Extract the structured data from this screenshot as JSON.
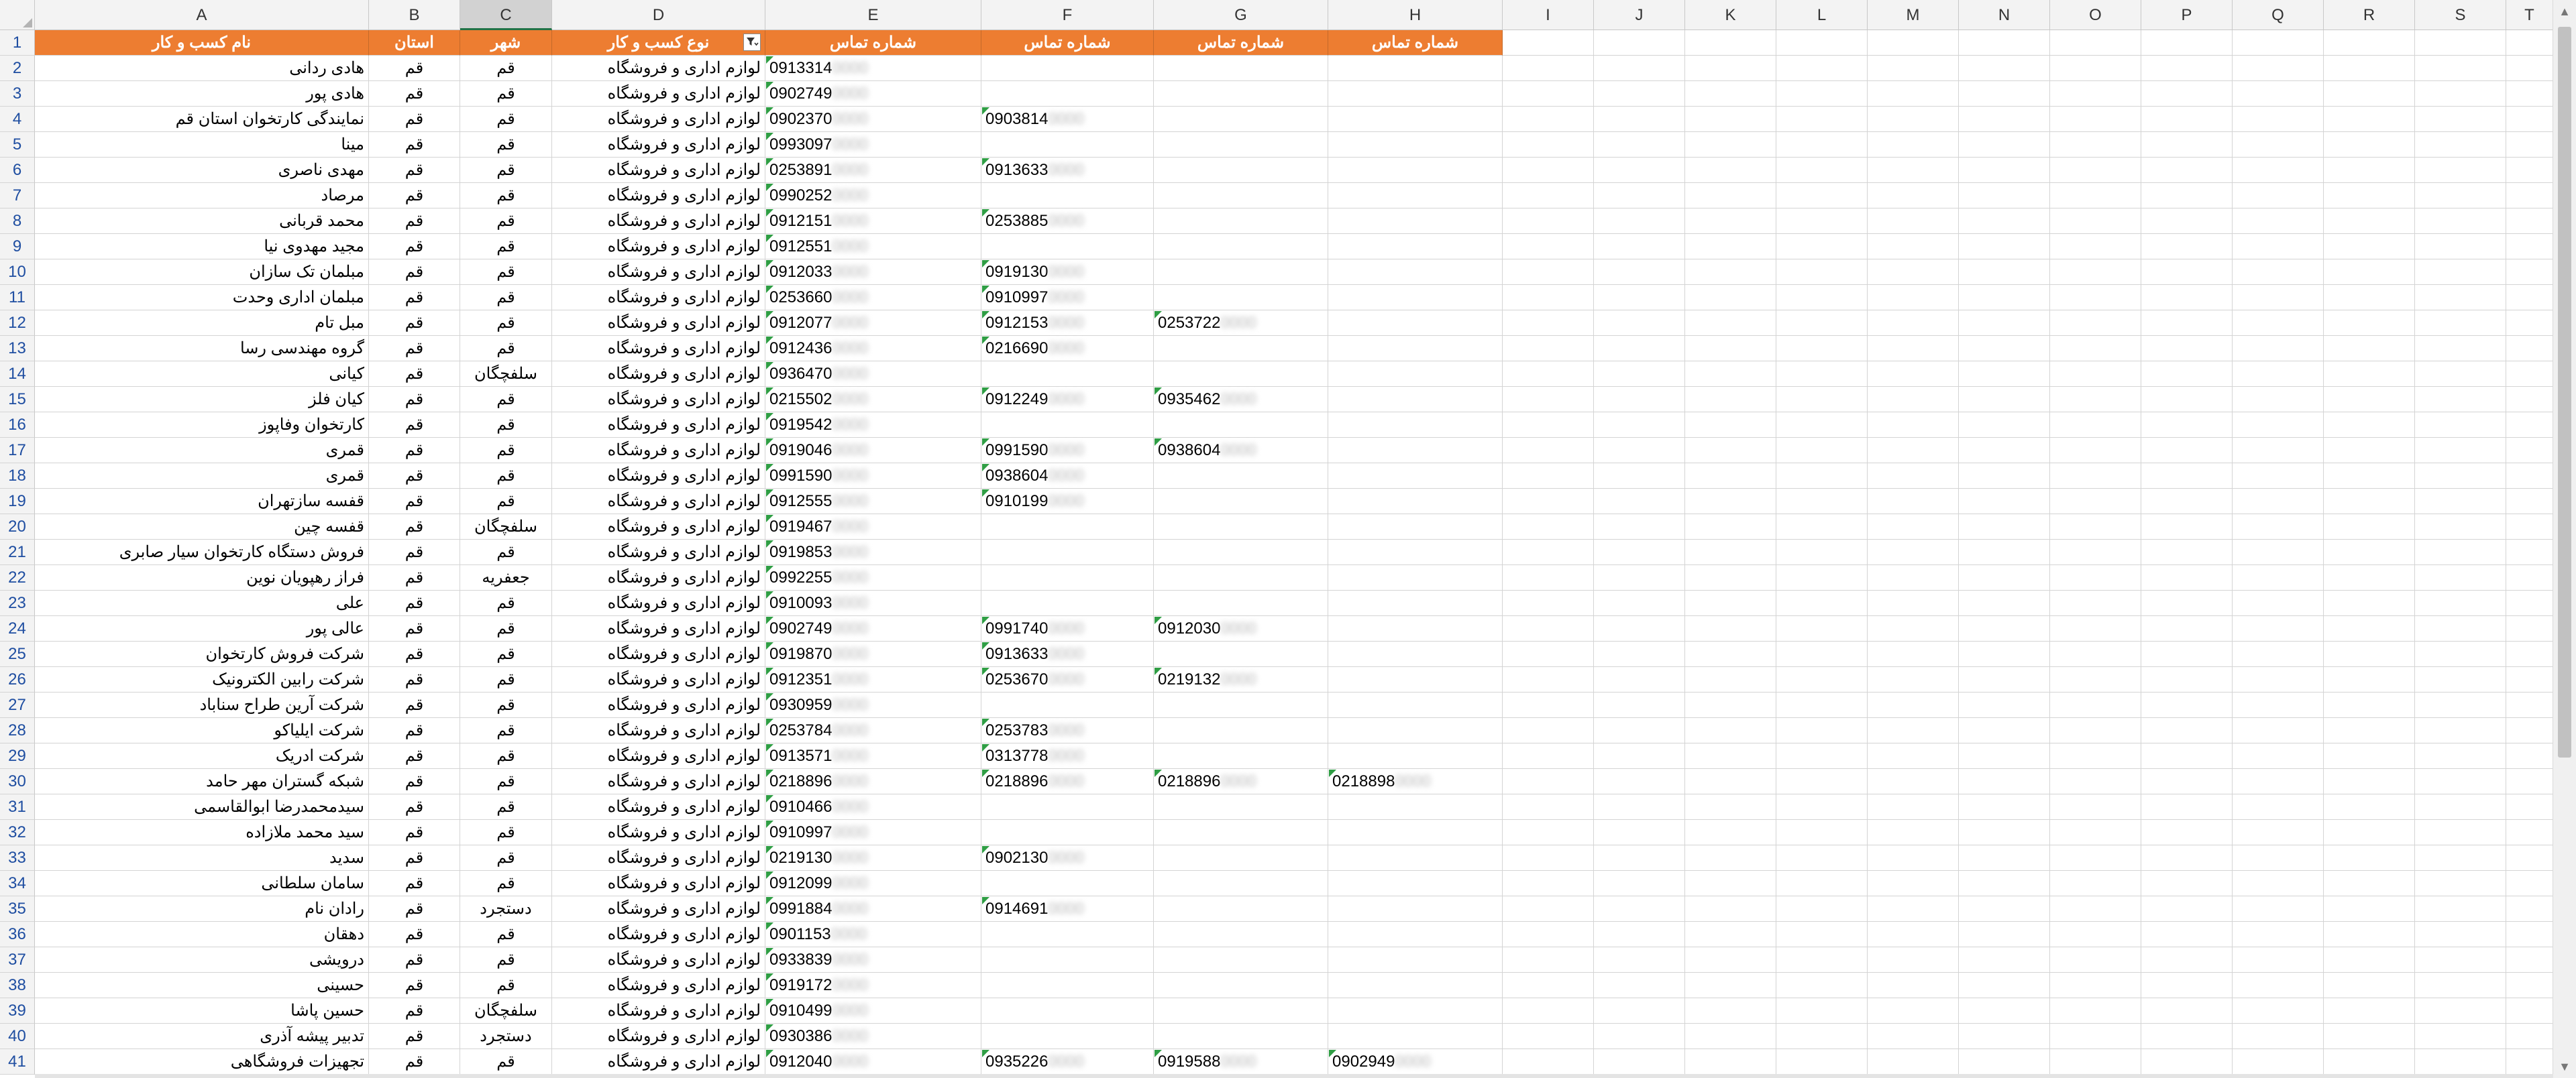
{
  "column_letters": [
    "A",
    "B",
    "C",
    "D",
    "E",
    "F",
    "G",
    "H",
    "I",
    "J",
    "K",
    "L",
    "M",
    "N",
    "O",
    "P",
    "Q",
    "R",
    "S",
    "T"
  ],
  "selected_column": "C",
  "header_accent": "#ed7d31",
  "headers": [
    "نام کسب و کار",
    "استان",
    "شهر",
    "نوع کسب و کار",
    "شماره تماس",
    "شماره تماس",
    "شماره تماس",
    "شماره تماس"
  ],
  "rows": [
    {
      "num": "2",
      "name": "هادی ردانی",
      "province": "قم",
      "city": "قم",
      "type": "لوازم اداری و فروشگاه",
      "phones": [
        "0913314",
        "",
        "",
        ""
      ]
    },
    {
      "num": "3",
      "name": "هادی پور",
      "province": "قم",
      "city": "قم",
      "type": "لوازم اداری و فروشگاه",
      "phones": [
        "0902749",
        "",
        "",
        ""
      ]
    },
    {
      "num": "4",
      "name": "نمایندگی کارتخوان استان قم",
      "province": "قم",
      "city": "قم",
      "type": "لوازم اداری و فروشگاه",
      "phones": [
        "0902370",
        "0903814",
        "",
        ""
      ]
    },
    {
      "num": "5",
      "name": "مینا",
      "province": "قم",
      "city": "قم",
      "type": "لوازم اداری و فروشگاه",
      "phones": [
        "0993097",
        "",
        "",
        ""
      ]
    },
    {
      "num": "6",
      "name": "مهدی ناصری",
      "province": "قم",
      "city": "قم",
      "type": "لوازم اداری و فروشگاه",
      "phones": [
        "0253891",
        "0913633",
        "",
        ""
      ]
    },
    {
      "num": "7",
      "name": "مرصاد",
      "province": "قم",
      "city": "قم",
      "type": "لوازم اداری و فروشگاه",
      "phones": [
        "0990252",
        "",
        "",
        ""
      ]
    },
    {
      "num": "8",
      "name": "محمد قربانی",
      "province": "قم",
      "city": "قم",
      "type": "لوازم اداری و فروشگاه",
      "phones": [
        "0912151",
        "0253885",
        "",
        ""
      ]
    },
    {
      "num": "9",
      "name": "مجید مهدوی نیا",
      "province": "قم",
      "city": "قم",
      "type": "لوازم اداری و فروشگاه",
      "phones": [
        "0912551",
        "",
        "",
        ""
      ]
    },
    {
      "num": "10",
      "name": "مبلمان تک سازان",
      "province": "قم",
      "city": "قم",
      "type": "لوازم اداری و فروشگاه",
      "phones": [
        "0912033",
        "0919130",
        "",
        ""
      ]
    },
    {
      "num": "11",
      "name": "مبلمان اداری وحدت",
      "province": "قم",
      "city": "قم",
      "type": "لوازم اداری و فروشگاه",
      "phones": [
        "0253660",
        "0910997",
        "",
        ""
      ]
    },
    {
      "num": "12",
      "name": "مبل تام",
      "province": "قم",
      "city": "قم",
      "type": "لوازم اداری و فروشگاه",
      "phones": [
        "0912077",
        "0912153",
        "0253722",
        ""
      ]
    },
    {
      "num": "13",
      "name": "گروه مهندسی رسا",
      "province": "قم",
      "city": "قم",
      "type": "لوازم اداری و فروشگاه",
      "phones": [
        "0912436",
        "0216690",
        "",
        ""
      ]
    },
    {
      "num": "14",
      "name": "کیانی",
      "province": "قم",
      "city": "سلفچگان",
      "type": "لوازم اداری و فروشگاه",
      "phones": [
        "0936470",
        "",
        "",
        ""
      ]
    },
    {
      "num": "15",
      "name": "کیان فلز",
      "province": "قم",
      "city": "قم",
      "type": "لوازم اداری و فروشگاه",
      "phones": [
        "0215502",
        "0912249",
        "0935462",
        ""
      ]
    },
    {
      "num": "16",
      "name": "کارتخوان وفاپوز",
      "province": "قم",
      "city": "قم",
      "type": "لوازم اداری و فروشگاه",
      "phones": [
        "0919542",
        "",
        "",
        ""
      ]
    },
    {
      "num": "17",
      "name": "قمری",
      "province": "قم",
      "city": "قم",
      "type": "لوازم اداری و فروشگاه",
      "phones": [
        "0919046",
        "0991590",
        "0938604",
        ""
      ]
    },
    {
      "num": "18",
      "name": "قمری",
      "province": "قم",
      "city": "قم",
      "type": "لوازم اداری و فروشگاه",
      "phones": [
        "0991590",
        "0938604",
        "",
        ""
      ]
    },
    {
      "num": "19",
      "name": "قفسه سازتهران",
      "province": "قم",
      "city": "قم",
      "type": "لوازم اداری و فروشگاه",
      "phones": [
        "0912555",
        "0910199",
        "",
        ""
      ]
    },
    {
      "num": "20",
      "name": "قفسه چین",
      "province": "قم",
      "city": "سلفچگان",
      "type": "لوازم اداری و فروشگاه",
      "phones": [
        "0919467",
        "",
        "",
        ""
      ]
    },
    {
      "num": "21",
      "name": "فروش دستگاه کارتخوان سیار صابری",
      "province": "قم",
      "city": "قم",
      "type": "لوازم اداری و فروشگاه",
      "phones": [
        "0919853",
        "",
        "",
        ""
      ]
    },
    {
      "num": "22",
      "name": "فراز رهپویان نوین",
      "province": "قم",
      "city": "جعفریه",
      "type": "لوازم اداری و فروشگاه",
      "phones": [
        "0992255",
        "",
        "",
        ""
      ]
    },
    {
      "num": "23",
      "name": "علی",
      "province": "قم",
      "city": "قم",
      "type": "لوازم اداری و فروشگاه",
      "phones": [
        "0910093",
        "",
        "",
        ""
      ]
    },
    {
      "num": "24",
      "name": "عالی پور",
      "province": "قم",
      "city": "قم",
      "type": "لوازم اداری و فروشگاه",
      "phones": [
        "0902749",
        "0991740",
        "0912030",
        ""
      ]
    },
    {
      "num": "25",
      "name": "شرکت فروش کارتخوان",
      "province": "قم",
      "city": "قم",
      "type": "لوازم اداری و فروشگاه",
      "phones": [
        "0919870",
        "0913633",
        "",
        ""
      ]
    },
    {
      "num": "26",
      "name": "شرکت رابین الکترونیک",
      "province": "قم",
      "city": "قم",
      "type": "لوازم اداری و فروشگاه",
      "phones": [
        "0912351",
        "0253670",
        "0219132",
        ""
      ]
    },
    {
      "num": "27",
      "name": "شرکت آرین طراح سناباد",
      "province": "قم",
      "city": "قم",
      "type": "لوازم اداری و فروشگاه",
      "phones": [
        "0930959",
        "",
        "",
        ""
      ]
    },
    {
      "num": "28",
      "name": "شرکت ایلیاکو",
      "province": "قم",
      "city": "قم",
      "type": "لوازم اداری و فروشگاه",
      "phones": [
        "0253784",
        "0253783",
        "",
        ""
      ]
    },
    {
      "num": "29",
      "name": "شرکت ادریک",
      "province": "قم",
      "city": "قم",
      "type": "لوازم اداری و فروشگاه",
      "phones": [
        "0913571",
        "0313778",
        "",
        ""
      ]
    },
    {
      "num": "30",
      "name": "شبکه گستران مهر حامد",
      "province": "قم",
      "city": "قم",
      "type": "لوازم اداری و فروشگاه",
      "phones": [
        "0218896",
        "0218896",
        "0218896",
        "0218898"
      ]
    },
    {
      "num": "31",
      "name": "سیدمحمدرضا ابوالقاسمی",
      "province": "قم",
      "city": "قم",
      "type": "لوازم اداری و فروشگاه",
      "phones": [
        "0910466",
        "",
        "",
        ""
      ]
    },
    {
      "num": "32",
      "name": "سید محمد ملازاده",
      "province": "قم",
      "city": "قم",
      "type": "لوازم اداری و فروشگاه",
      "phones": [
        "0910997",
        "",
        "",
        ""
      ]
    },
    {
      "num": "33",
      "name": "سدید",
      "province": "قم",
      "city": "قم",
      "type": "لوازم اداری و فروشگاه",
      "phones": [
        "0219130",
        "0902130",
        "",
        ""
      ]
    },
    {
      "num": "34",
      "name": "سامان سلطانی",
      "province": "قم",
      "city": "قم",
      "type": "لوازم اداری و فروشگاه",
      "phones": [
        "0912099",
        "",
        "",
        ""
      ]
    },
    {
      "num": "35",
      "name": "رادان نام",
      "province": "قم",
      "city": "دستجرد",
      "type": "لوازم اداری و فروشگاه",
      "phones": [
        "0991884",
        "0914691",
        "",
        ""
      ]
    },
    {
      "num": "36",
      "name": "دهقان",
      "province": "قم",
      "city": "قم",
      "type": "لوازم اداری و فروشگاه",
      "phones": [
        "0901153",
        "",
        "",
        ""
      ]
    },
    {
      "num": "37",
      "name": "درویشی",
      "province": "قم",
      "city": "قم",
      "type": "لوازم اداری و فروشگاه",
      "phones": [
        "0933839",
        "",
        "",
        ""
      ]
    },
    {
      "num": "38",
      "name": "حسینی",
      "province": "قم",
      "city": "قم",
      "type": "لوازم اداری و فروشگاه",
      "phones": [
        "0919172",
        "",
        "",
        ""
      ]
    },
    {
      "num": "39",
      "name": "حسین پاشا",
      "province": "قم",
      "city": "سلفچگان",
      "type": "لوازم اداری و فروشگاه",
      "phones": [
        "0910499",
        "",
        "",
        ""
      ]
    },
    {
      "num": "40",
      "name": "تدبیر پیشه آذری",
      "province": "قم",
      "city": "دستجرد",
      "type": "لوازم اداری و فروشگاه",
      "phones": [
        "0930386",
        "",
        "",
        ""
      ]
    },
    {
      "num": "41",
      "name": "تجهیزات فروشگاهی",
      "province": "قم",
      "city": "قم",
      "type": "لوازم اداری و فروشگاه",
      "phones": [
        "0912040",
        "0935226",
        "0919588",
        "0902949"
      ]
    }
  ]
}
